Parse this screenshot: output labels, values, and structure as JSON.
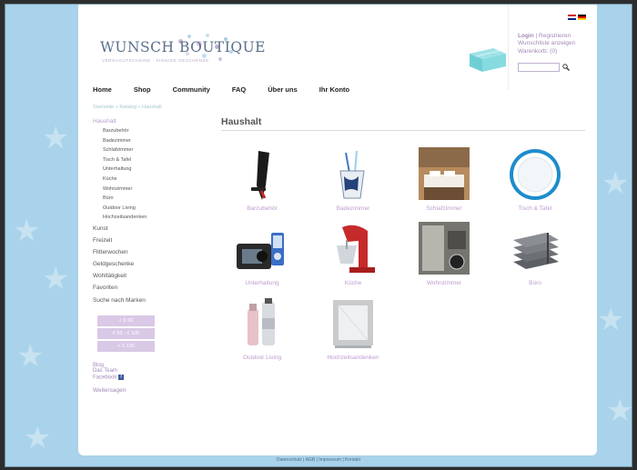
{
  "logo": {
    "name": "WUNSCH BOUTIQUE",
    "tagline": "VERSAGUTSCHEINE · SINNIGE GESCHENKE"
  },
  "languages": [
    {
      "code": "en",
      "label": "English"
    },
    {
      "code": "de",
      "label": "Deutsch"
    }
  ],
  "account": {
    "login": "Login",
    "separator": " | ",
    "register": "Registrieren",
    "wishlist": "Wunschliste anzeigen",
    "cart": "Warenkorb: (0)"
  },
  "search": {
    "placeholder": "",
    "icon": "magnifier-icon"
  },
  "nav": {
    "items": [
      "Home",
      "Shop",
      "Community",
      "FAQ",
      "Über uns",
      "Ihr Konto"
    ]
  },
  "breadcrumb": "Startseite » Katalog » Haushalt",
  "sidebar": {
    "active": "Haushalt",
    "subcategories": [
      "Barzubehör",
      "Badezimmer",
      "Schlafzimmer",
      "Tisch & Tafel",
      "Unterhaltung",
      "Küche",
      "Wohnzimmer",
      "Büro",
      "Outdoor Living",
      "Hochzeitsandenken"
    ],
    "categories": [
      "Kunst",
      "Freizeit",
      "Flitterwochen",
      "Geldgeschenke",
      "Wohltätigkeit",
      "Favoriten",
      "Suche nach Marken"
    ],
    "price_filters": [
      "< € 50",
      "€ 50 - € 100",
      "> € 100"
    ],
    "links": {
      "blog": "Blog",
      "team": "Das Team",
      "facebook": "Facebook"
    },
    "last": "Weitersagen"
  },
  "content": {
    "title": "Haushalt",
    "products": [
      {
        "label": "Barzubehör",
        "icon": "corkscrew-icon"
      },
      {
        "label": "Badezimmer",
        "icon": "toothbrush-cup-icon"
      },
      {
        "label": "Schlafzimmer",
        "icon": "bedroom-icon"
      },
      {
        "label": "Tisch & Tafel",
        "icon": "plate-icon"
      },
      {
        "label": "Unterhaltung",
        "icon": "ipod-dock-icon"
      },
      {
        "label": "Küche",
        "icon": "stand-mixer-icon"
      },
      {
        "label": "Wohnzimmer",
        "icon": "living-room-icon"
      },
      {
        "label": "Büro",
        "icon": "letter-tray-icon"
      },
      {
        "label": "Outdoor Living",
        "icon": "bottles-icon"
      },
      {
        "label": "Hochzeitsandenken",
        "icon": "picture-frame-icon"
      }
    ]
  },
  "footer": "Datenschutz | AGB | Impressum | Kontakt",
  "colors": {
    "background": "#a9d3ea",
    "accent": "#a388b7",
    "price_button": "#d9c8e6"
  }
}
